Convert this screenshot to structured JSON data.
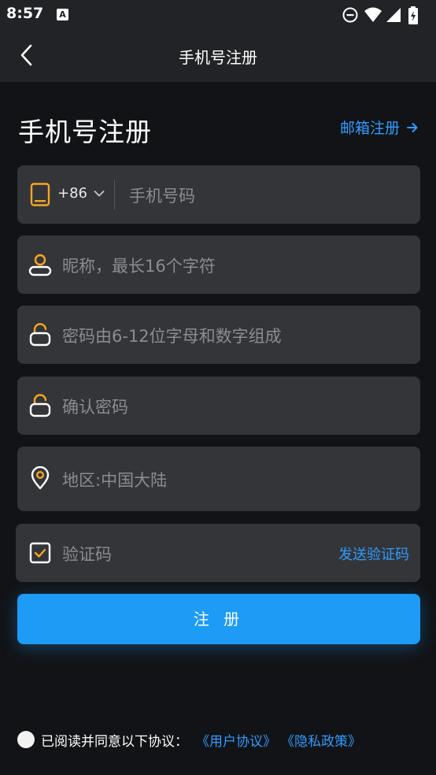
{
  "status": {
    "time": "8:57",
    "notification": "A"
  },
  "app_bar": {
    "title": "手机号注册"
  },
  "page": {
    "heading": "手机号注册",
    "email_register_label": "邮箱注册"
  },
  "form": {
    "country_code": "+86",
    "phone_placeholder": "手机号码",
    "nickname_placeholder": "昵称，最长16个字符",
    "password_placeholder": "密码由6-12位字母和数字组成",
    "confirm_password_placeholder": "确认密码",
    "region_value": "地区:中国大陆",
    "code_placeholder": "验证码",
    "send_code_label": "发送验证码"
  },
  "register_button": "注 册",
  "agreement": {
    "prefix": "已阅读并同意以下协议：",
    "user_agreement": "《用户协议》",
    "privacy_policy": "《隐私政策》",
    "checked": false
  },
  "colors": {
    "background": "#121316",
    "bar": "#222326",
    "field": "#343538",
    "accent": "#2f9bff",
    "icon_orange": "#f5a623",
    "button": "#1d9bf5"
  },
  "icons": {
    "back": "chevron-left-icon",
    "phone": "phone-icon",
    "user": "user-icon",
    "lock": "lock-icon",
    "location": "location-pin-icon",
    "verify": "checkbox-icon",
    "arrow": "arrow-right-icon"
  }
}
